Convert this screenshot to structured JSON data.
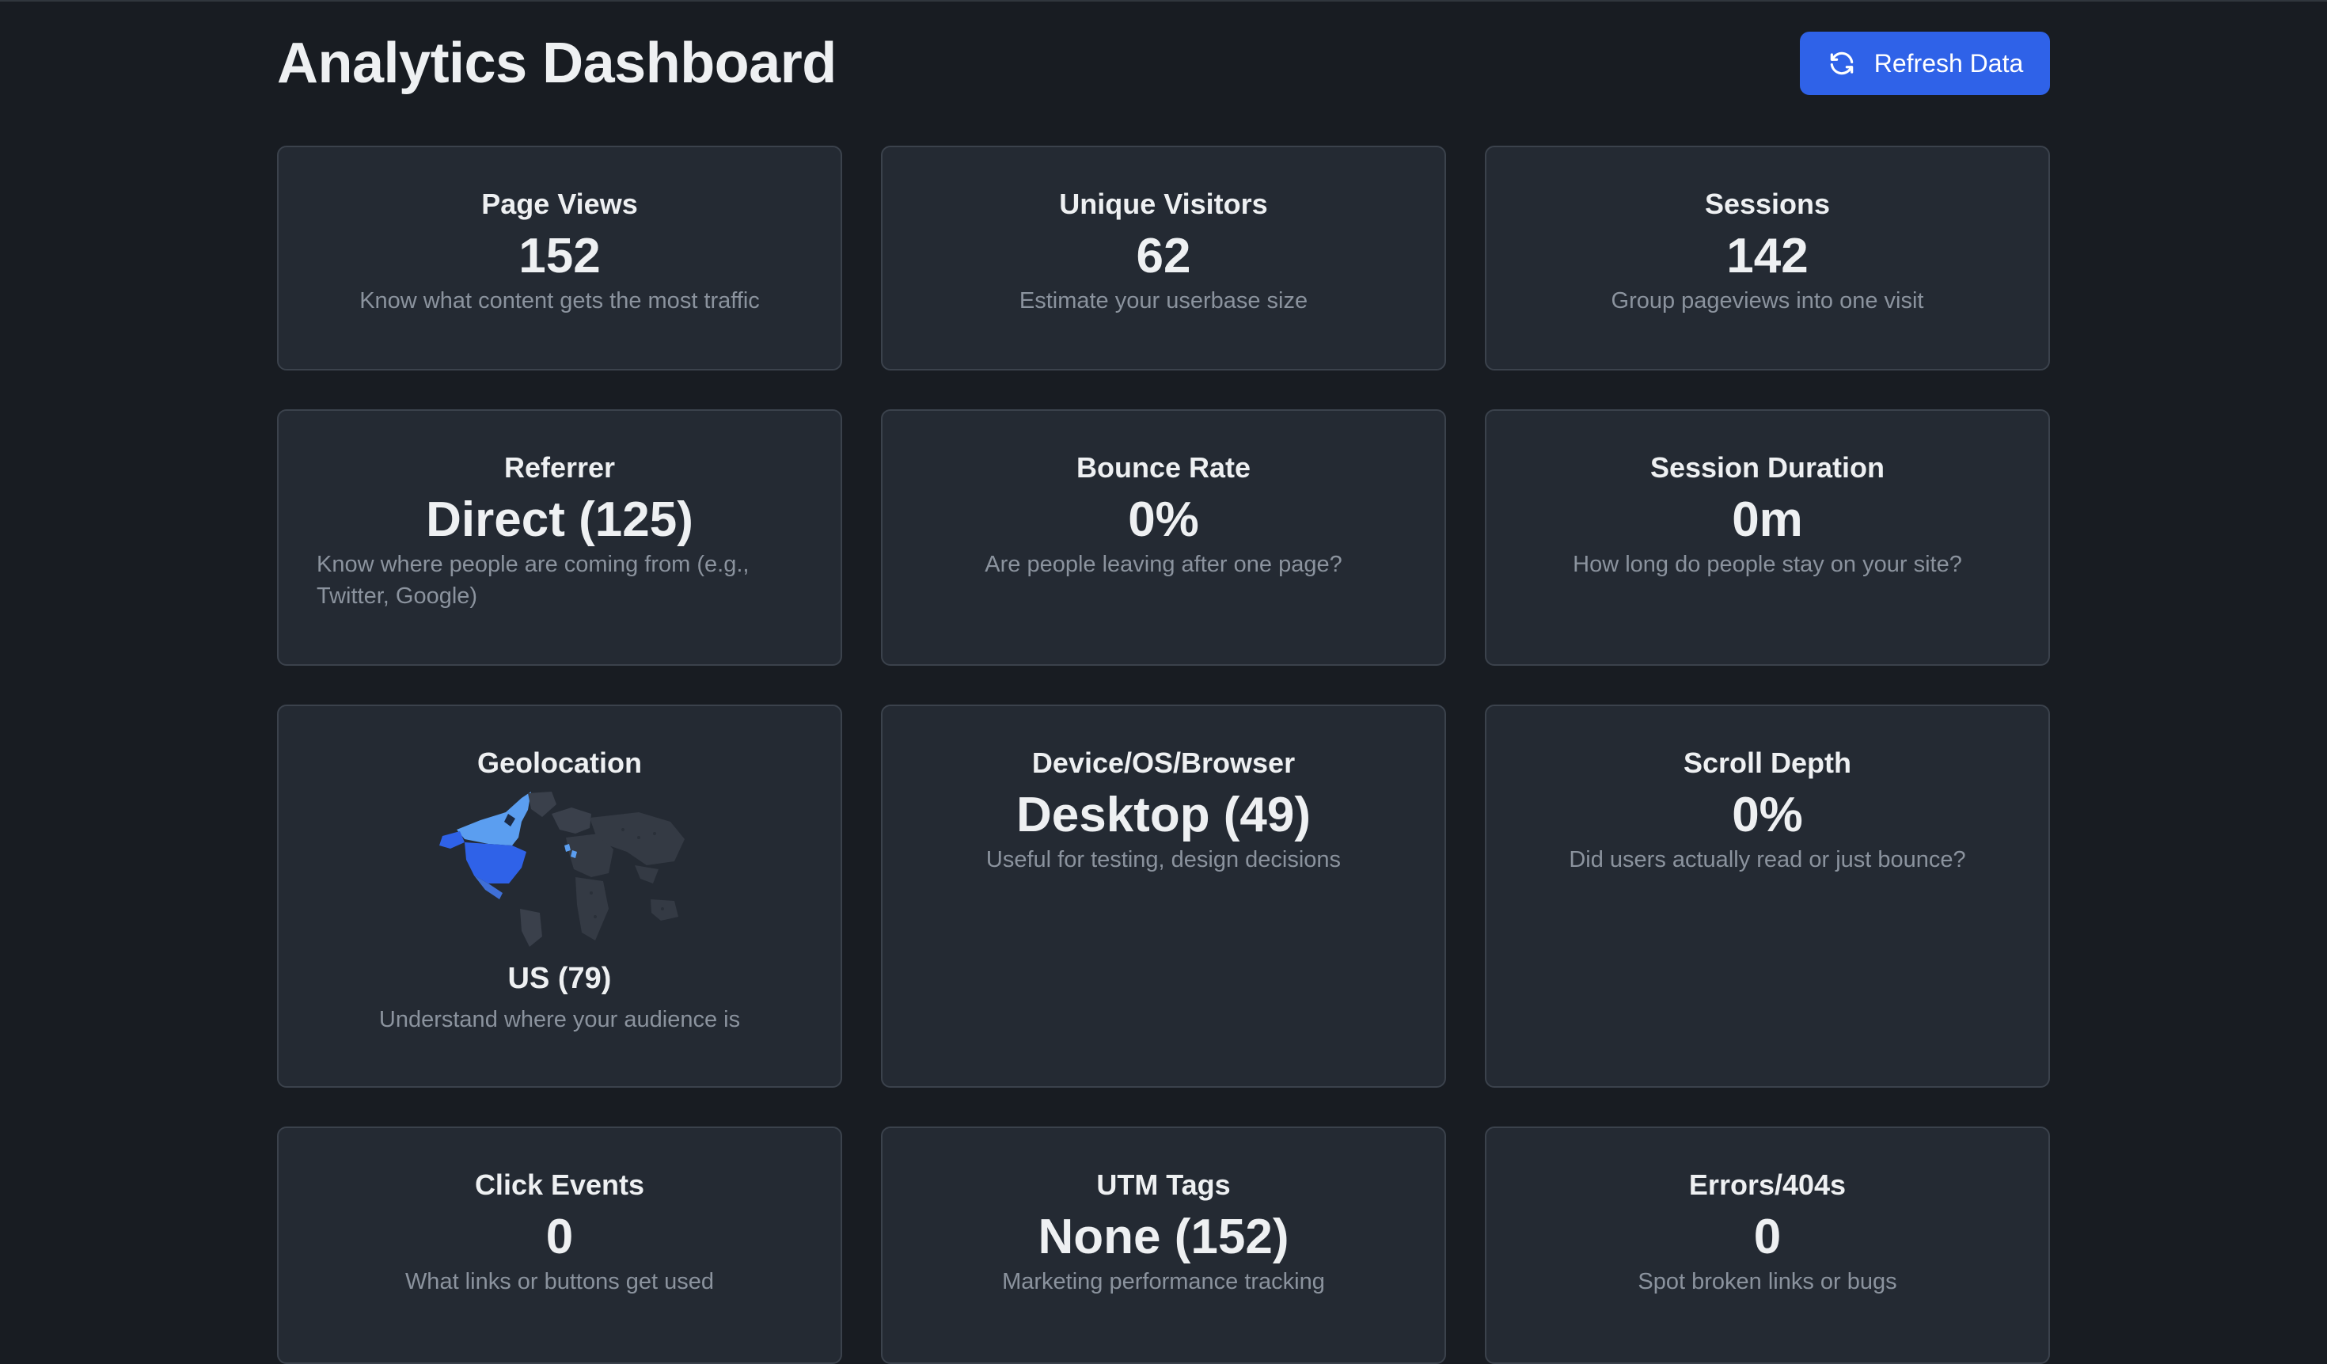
{
  "header": {
    "title": "Analytics Dashboard",
    "refresh_label": "Refresh Data",
    "refresh_icon": "refresh-icon"
  },
  "colors": {
    "background": "#181c22",
    "card": "#242a33",
    "card_border": "#3b424c",
    "accent": "#2f62e8",
    "muted_text": "#8b939e",
    "map_highlight": "#5b9ef0",
    "map_strong": "#2f62e8"
  },
  "cards": {
    "page_views": {
      "title": "Page Views",
      "value": "152",
      "desc": "Know what content gets the most traffic"
    },
    "unique_visitors": {
      "title": "Unique Visitors",
      "value": "62",
      "desc": "Estimate your userbase size"
    },
    "sessions": {
      "title": "Sessions",
      "value": "142",
      "desc": "Group pageviews into one visit"
    },
    "referrer": {
      "title": "Referrer",
      "value": "Direct (125)",
      "desc": "Know where people are coming from (e.g., Twitter, Google)"
    },
    "bounce_rate": {
      "title": "Bounce Rate",
      "value": "0%",
      "desc": "Are people leaving after one page?"
    },
    "session_duration": {
      "title": "Session Duration",
      "value": "0m",
      "desc": "How long do people stay on your site?"
    },
    "geolocation": {
      "title": "Geolocation",
      "value": "US (79)",
      "desc": "Understand where your audience is",
      "map_icon": "world-map-icon"
    },
    "device": {
      "title": "Device/OS/Browser",
      "value": "Desktop (49)",
      "desc": "Useful for testing, design decisions"
    },
    "scroll_depth": {
      "title": "Scroll Depth",
      "value": "0%",
      "desc": "Did users actually read or just bounce?"
    },
    "click_events": {
      "title": "Click Events",
      "value": "0",
      "desc": "What links or buttons get used"
    },
    "utm_tags": {
      "title": "UTM Tags",
      "value": "None (152)",
      "desc": "Marketing performance tracking"
    },
    "errors": {
      "title": "Errors/404s",
      "value": "0",
      "desc": "Spot broken links or bugs"
    }
  }
}
